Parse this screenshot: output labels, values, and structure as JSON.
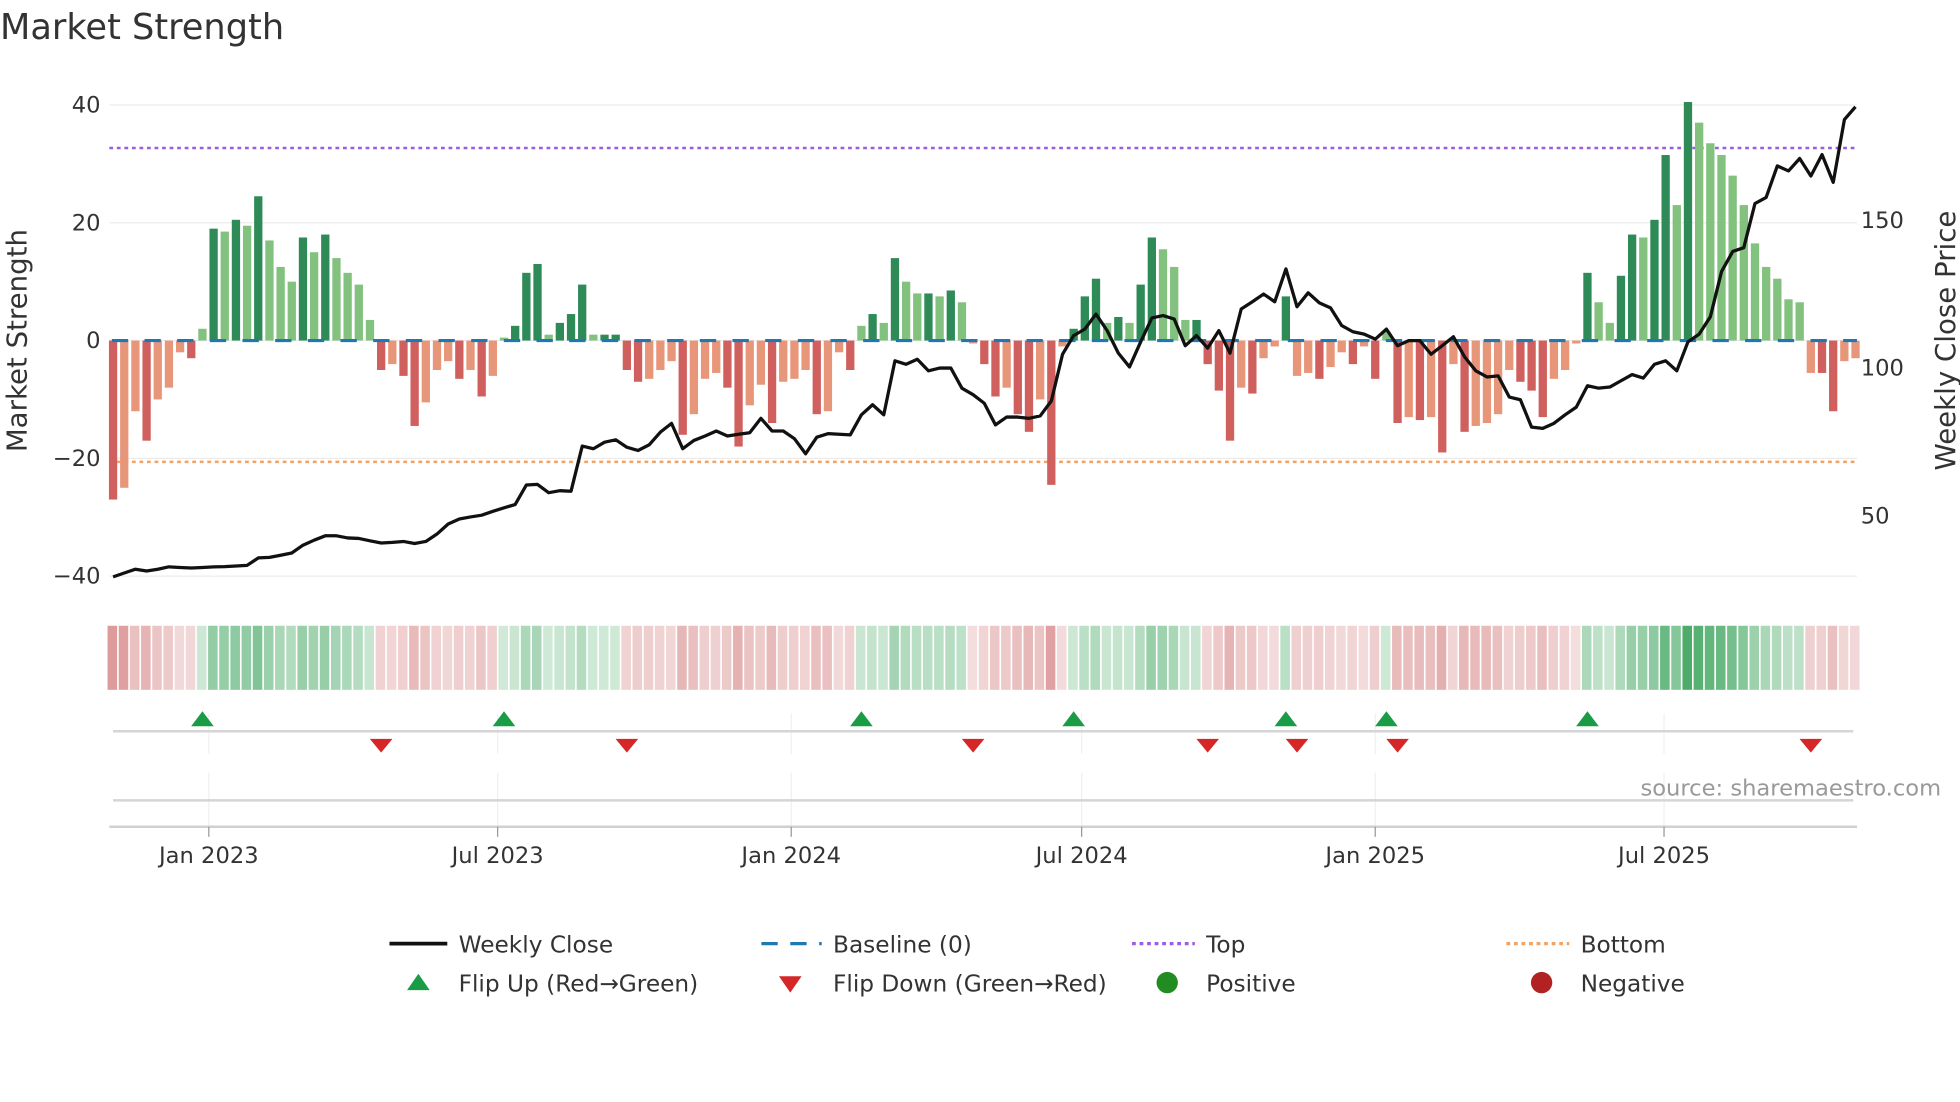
{
  "chart_data": {
    "type": "bar",
    "title": "Market Strength",
    "ylabel": "Market Strength",
    "y2label": "Weekly Close Price",
    "ylim": [
      -43,
      43
    ],
    "y2lim": [
      20,
      195
    ],
    "yticks": [
      40,
      20,
      0,
      -20,
      -40
    ],
    "ytick_labels": [
      "40",
      "20",
      "0",
      "−20",
      "−40"
    ],
    "y2ticks": [
      50,
      100,
      150
    ],
    "y2tick_labels": [
      "50",
      "100",
      "150"
    ],
    "x_start": "2022-11-02",
    "x_step_days": 7,
    "xticks": [
      {
        "label": "Jan 2023",
        "date": "2023-01-01"
      },
      {
        "label": "Jul 2023",
        "date": "2023-07-01"
      },
      {
        "label": "Jan 2024",
        "date": "2024-01-01"
      },
      {
        "label": "Jul 2024",
        "date": "2024-07-01"
      },
      {
        "label": "Jan 2025",
        "date": "2025-01-01"
      },
      {
        "label": "Jul 2025",
        "date": "2025-07-01"
      }
    ],
    "top_level": 32.7,
    "bottom_level": -20.6,
    "baseline": 0,
    "strength": [
      -27,
      -25,
      -12,
      -17,
      -10,
      -8,
      -2,
      -3,
      2,
      19,
      18.5,
      20.5,
      19.5,
      24.5,
      17,
      12.5,
      10,
      17.5,
      15,
      18,
      14,
      11.5,
      9.5,
      3.5,
      -5,
      -4,
      -6,
      -14.5,
      -10.5,
      -5,
      -3.5,
      -6.5,
      -5,
      -9.5,
      -6,
      0.5,
      2.5,
      11.5,
      13,
      1,
      3,
      4.5,
      9.5,
      1,
      1,
      1,
      -5,
      -7,
      -6.5,
      -5,
      -3.5,
      -16,
      -12.5,
      -6.5,
      -5.5,
      -8,
      -18,
      -11,
      -7.5,
      -14,
      -7,
      -6.5,
      -5,
      -12.5,
      -12,
      -2,
      -5,
      2.5,
      4.5,
      3,
      14,
      10,
      8,
      8,
      7.5,
      8.5,
      6.5,
      -0.5,
      -4,
      -9.5,
      -8,
      -12.5,
      -15.5,
      -10,
      -24.5,
      -1,
      2,
      7.5,
      10.5,
      3,
      4,
      3,
      9.5,
      17.5,
      15.5,
      12.5,
      3.5,
      3.5,
      -4,
      -8.5,
      -17,
      -8,
      -9,
      -3,
      -1,
      7.5,
      -6,
      -5.5,
      -6.5,
      -4.5,
      -2,
      -4,
      -1,
      -6.5,
      1.5,
      -14,
      -13,
      -13.5,
      -13,
      -19,
      -4,
      -15.5,
      -14.5,
      -14,
      -12.5,
      -5,
      -7,
      -8.5,
      -13,
      -6.5,
      -5,
      -0.5,
      11.5,
      6.5,
      3,
      11,
      18,
      17.5,
      20.5,
      31.5,
      23,
      40.5,
      37,
      33.5,
      31.5,
      28,
      23,
      16.5,
      12.5,
      10.5,
      7,
      6.5,
      -5.5,
      -5.5,
      -12,
      -3.5,
      -3
    ],
    "weekly_close": [
      28.9,
      30.2,
      31.5,
      30.9,
      31.5,
      32.3,
      32.1,
      31.9,
      32.1,
      32.3,
      32.4,
      32.6,
      32.8,
      35.3,
      35.5,
      36.2,
      37.0,
      39.6,
      41.3,
      42.8,
      42.8,
      42.1,
      41.9,
      41.1,
      40.4,
      40.6,
      40.9,
      40.2,
      40.9,
      43.4,
      46.8,
      48.5,
      49.2,
      49.8,
      51.1,
      52.3,
      53.4,
      60.0,
      60.2,
      57.4,
      58.1,
      57.9,
      73.2,
      72.3,
      74.5,
      75.3,
      72.8,
      71.7,
      73.6,
      77.9,
      80.9,
      72.3,
      75.1,
      76.6,
      78.3,
      76.6,
      77.2,
      77.7,
      82.6,
      78.3,
      78.3,
      75.7,
      70.6,
      76.2,
      77.4,
      77.2,
      77.0,
      83.8,
      87.2,
      83.8,
      102.1,
      100.9,
      102.6,
      98.7,
      99.6,
      99.6,
      92.8,
      90.6,
      87.7,
      80.4,
      83.0,
      83.0,
      82.6,
      83.4,
      88.5,
      104.3,
      110.6,
      112.8,
      117.9,
      112.3,
      104.7,
      100.0,
      108.5,
      116.6,
      117.4,
      116.2,
      107.2,
      110.6,
      106.4,
      112.3,
      104.7,
      119.6,
      122.1,
      124.7,
      122.1,
      133.2,
      120.4,
      125.1,
      121.7,
      120.0,
      114.0,
      111.9,
      111.1,
      109.4,
      112.8,
      107.2,
      108.9,
      108.9,
      104.3,
      107.2,
      110.2,
      103.4,
      98.7,
      96.6,
      97.0,
      89.8,
      88.9,
      79.6,
      79.2,
      80.9,
      83.8,
      86.4,
      93.6,
      92.8,
      93.2,
      95.3,
      97.4,
      96.2,
      100.9,
      102.1,
      98.7,
      108.5,
      111.1,
      117.0,
      132.3,
      139.1,
      140.4,
      155.3,
      157.4,
      168.1,
      166.4,
      170.6,
      164.7,
      171.9,
      162.5,
      183.8,
      188.1
    ],
    "flip_up_weeks": [
      8,
      35,
      67,
      86,
      105,
      114,
      132
    ],
    "flip_down_weeks": [
      24,
      46,
      77,
      98,
      106,
      115,
      152
    ],
    "legend": [
      {
        "label": "Weekly Close",
        "symbol": "line",
        "color": "#111111"
      },
      {
        "label": "Baseline (0)",
        "symbol": "dash",
        "color": "#1f77b4"
      },
      {
        "label": "Top",
        "symbol": "dot",
        "color": "#9b5de5"
      },
      {
        "label": "Bottom",
        "symbol": "dot",
        "color": "#f4a261"
      },
      {
        "label": "Flip Up (Red→Green)",
        "symbol": "tri-up",
        "color": "#1a9c47"
      },
      {
        "label": "Flip Down (Green→Red)",
        "symbol": "tri-down",
        "color": "#d62728"
      },
      {
        "label": "Positive",
        "symbol": "circle",
        "color": "#228b22"
      },
      {
        "label": "Negative",
        "symbol": "circle",
        "color": "#b22222"
      }
    ],
    "legend_placement": "bottom",
    "grid": true
  },
  "source": "source: sharemaestro.com",
  "colors": {
    "pos_strong": "#2e8b57",
    "pos_weak": "#82c17e",
    "neg_strong": "#d0605e",
    "neg_weak": "#e8967a",
    "top": "#9b5de5",
    "bottom": "#f4a261",
    "baseline": "#1f77b4",
    "line": "#111111",
    "up": "#1a9c47",
    "down": "#d62728"
  }
}
